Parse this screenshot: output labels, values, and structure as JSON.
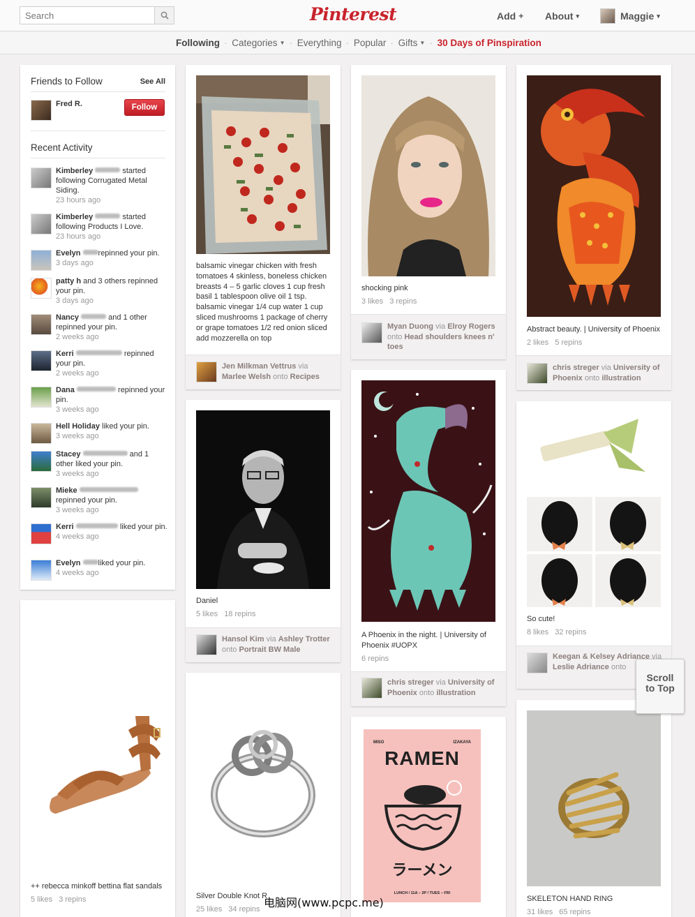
{
  "header": {
    "search_placeholder": "Search",
    "logo": "Pinterest",
    "nav": [
      {
        "label": "Add",
        "suffix": "+"
      },
      {
        "label": "About",
        "suffix": "▾"
      },
      {
        "label": "Maggie",
        "suffix": "▾"
      }
    ]
  },
  "subnav": {
    "items": [
      {
        "label": "Following",
        "active": true
      },
      {
        "label": "Categories",
        "caret": true
      },
      {
        "label": "Everything"
      },
      {
        "label": "Popular"
      },
      {
        "label": "Gifts",
        "caret": true
      },
      {
        "label": "30 Days of Pinspiration",
        "promo": true
      }
    ]
  },
  "sidebar": {
    "friends_title": "Friends to Follow",
    "see_all": "See All",
    "friend_name": "Fred R.",
    "follow_label": "Follow",
    "recent_title": "Recent Activity",
    "activity": [
      {
        "name": "Kimberley",
        "text": "started following Corrugated Metal Siding.",
        "time": "23 hours ago"
      },
      {
        "name": "Kimberley",
        "text": "started following Products I Love.",
        "time": "23 hours ago"
      },
      {
        "name": "Evelyn",
        "text": "repinned your pin.",
        "time": "3 days ago"
      },
      {
        "name": "patty h",
        "text": "and 3 others repinned your pin.",
        "time": "3 days ago"
      },
      {
        "name": "Nancy",
        "text": "and 1 other repinned your pin.",
        "time": "2 weeks ago"
      },
      {
        "name": "Kerri",
        "text": "repinned your pin.",
        "time": "2 weeks ago"
      },
      {
        "name": "Dana",
        "text": "repinned your pin.",
        "time": "3 weeks ago"
      },
      {
        "name": "Hell Holiday",
        "text": "liked your pin.",
        "time": "3 weeks ago"
      },
      {
        "name": "Stacey",
        "text": "and 1 other liked your pin.",
        "time": "3 weeks ago"
      },
      {
        "name": "Mieke",
        "text": "repinned your pin.",
        "time": "3 weeks ago"
      },
      {
        "name": "Kerri",
        "text": "liked your pin.",
        "time": "4 weeks ago"
      },
      {
        "name": "Evelyn",
        "text": "liked your pin.",
        "time": "4 weeks ago"
      }
    ]
  },
  "pins": {
    "sandals": {
      "desc": "++ rebecca minkoff bettina flat sandals",
      "likes": "5 likes",
      "repins": "3 repins"
    },
    "chicken": {
      "desc": "balsamic vinegar chicken with fresh tomatoes 4 skinless, boneless chicken breasts 4 – 5 garlic cloves 1 cup fresh basil 1 tablespoon olive oil 1 tsp. balsamic vinegar 1/4 cup water 1 cup sliced mushrooms 1 package of cherry or grape tomatoes 1/2 red onion sliced add mozzerella on top",
      "user": "Jen Milkman Vettrus",
      "via": "via",
      "via_user": "Marlee Welsh",
      "onto": "onto",
      "board": "Recipes"
    },
    "daniel": {
      "desc": "Daniel",
      "likes": "5 likes",
      "repins": "18 repins",
      "user": "Hansol Kim",
      "via": "via",
      "via_user": "Ashley Trotter",
      "onto": "onto",
      "board": "Portrait BW Male"
    },
    "ring_knot": {
      "desc": "Silver Double Knot R",
      "likes": "25 likes",
      "repins": "34 repins"
    },
    "pink": {
      "desc": "shocking pink",
      "likes": "3 likes",
      "repins": "3 repins",
      "user": "Myan Duong",
      "via": "via",
      "via_user": "Elroy Rogers",
      "onto": "onto",
      "board": "Head shoulders knees n' toes"
    },
    "phoenix_night": {
      "desc": "A Phoenix in the night. | University of Phoenix #UOPX",
      "repins": "6 repins",
      "user": "chris streger",
      "via": "via",
      "via_user": "University of Phoenix",
      "onto": "onto",
      "board": "illustration"
    },
    "ramen": {
      "top_left": "MISO",
      "top_right": "IZAKAYA",
      "title": "RAMEN",
      "jp": "ラーメン",
      "footer": "LUNCH / 11A – 2P / TUES – FRI"
    },
    "abstract": {
      "desc": "Abstract beauty. | University of Phoenix",
      "likes": "2 likes",
      "repins": "5 repins",
      "user": "chris streger",
      "via": "via",
      "via_user": "University of Phoenix",
      "onto": "onto",
      "board": "illustration"
    },
    "dogs": {
      "desc": "So cute!",
      "likes": "8 likes",
      "repins": "32 repins",
      "user": "Keegan & Kelsey Adriance",
      "via": "via",
      "via_user": "Leslie Adriance",
      "onto": "onto"
    },
    "skeleton": {
      "desc": "SKELETON HAND RING",
      "likes": "31 likes",
      "repins": "65 repins"
    }
  },
  "scroll_top": {
    "line1": "Scroll",
    "line2": "to Top"
  },
  "watermark": "电脑网(www.pcpc.me)",
  "colors": {
    "brand": "#c8232c",
    "background": "#f2f0f0"
  }
}
